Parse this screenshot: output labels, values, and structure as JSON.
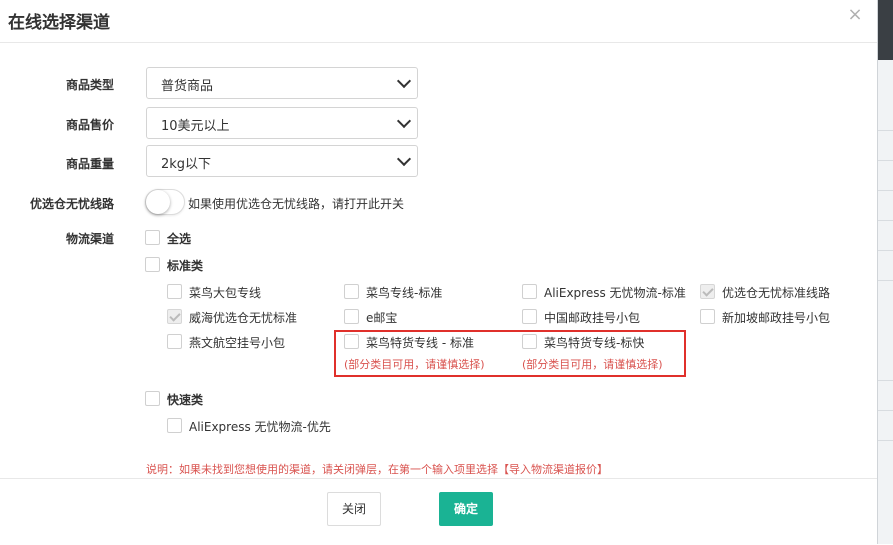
{
  "dialog": {
    "title": "在线选择渠道",
    "close_glyph": "×"
  },
  "form": {
    "product_type": {
      "label": "商品类型",
      "value": "普货商品"
    },
    "product_price": {
      "label": "商品售价",
      "value": "10美元以上"
    },
    "product_weight": {
      "label": "商品重量",
      "value": "2kg以下"
    },
    "preferred_route": {
      "label": "优选仓无忧线路",
      "hint": "如果使用优选仓无忧线路，请打开此开关",
      "enabled": false
    },
    "logistics": {
      "label": "物流渠道",
      "select_all": "全选",
      "standard_group": {
        "label": "标准类",
        "items": [
          {
            "label": "菜鸟大包专线",
            "checked": false
          },
          {
            "label": "菜鸟专线-标准",
            "checked": false
          },
          {
            "label": "AliExpress 无忧物流-标准",
            "checked": false
          },
          {
            "label": "优选仓无忧标准线路",
            "checked": true
          },
          {
            "label": "威海优选仓无忧标准",
            "checked": true
          },
          {
            "label": "e邮宝",
            "checked": false
          },
          {
            "label": "中国邮政挂号小包",
            "checked": false
          },
          {
            "label": "新加坡邮政挂号小包",
            "checked": false
          },
          {
            "label": "燕文航空挂号小包",
            "checked": false
          },
          {
            "label": "菜鸟特货专线 - 标准",
            "note": "(部分类目可用，请谨慎选择)",
            "checked": false
          },
          {
            "label": "菜鸟特货专线-标快",
            "note": "(部分类目可用，请谨慎选择)",
            "checked": false
          }
        ]
      },
      "express_group": {
        "label": "快速类",
        "items": [
          {
            "label": "AliExpress 无忧物流-优先",
            "checked": false
          }
        ]
      }
    },
    "note": "说明：如果未找到您想使用的渠道，请关闭弹层，在第一个输入项里选择【导入物流渠道报价】"
  },
  "buttons": {
    "close": "关闭",
    "confirm": "确定"
  },
  "colors": {
    "primary": "#1ab394",
    "warning_text": "#d9534f",
    "highlight_border": "#e0302b"
  }
}
